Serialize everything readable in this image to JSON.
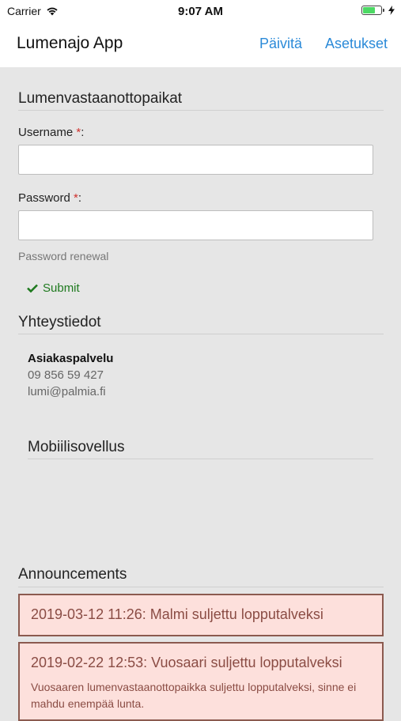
{
  "status_bar": {
    "carrier": "Carrier",
    "time": "9:07 AM",
    "battery_level": 0.7,
    "colors": {
      "battery": "#4cd964"
    }
  },
  "navbar": {
    "title": "Lumenajo App",
    "refresh_label": "Päivitä",
    "settings_label": "Asetukset",
    "accent": "#2b8ad8"
  },
  "login": {
    "section_title": "Lumenvastaanottopaikat",
    "username_label": "Username",
    "password_label": "Password",
    "required_mark": "*",
    "colon": ":",
    "username_value": "",
    "password_value": "",
    "password_renewal": "Password renewal",
    "submit_label": "Submit"
  },
  "contact": {
    "section_title": "Yhteystiedot",
    "name": "Asiakaspalvelu",
    "phone": "09 856 59 427",
    "email": "lumi@palmia.fi"
  },
  "mobile": {
    "section_title": "Mobiilisovellus"
  },
  "announcements": {
    "section_title": "Announcements",
    "items": [
      {
        "heading": "2019-03-12 11:26: Malmi suljettu lopputalveksi",
        "body": ""
      },
      {
        "heading": "2019-02-22 12:53: Vuosaari suljettu lopputalveksi",
        "body": "Vuosaaren lumenvastaanottopaikka suljettu lopputalveksi, sinne ei mahdu enempää lunta."
      }
    ],
    "colors": {
      "background": "#fde0dc",
      "border": "#8b5a4f",
      "text": "#8a4c44"
    }
  }
}
